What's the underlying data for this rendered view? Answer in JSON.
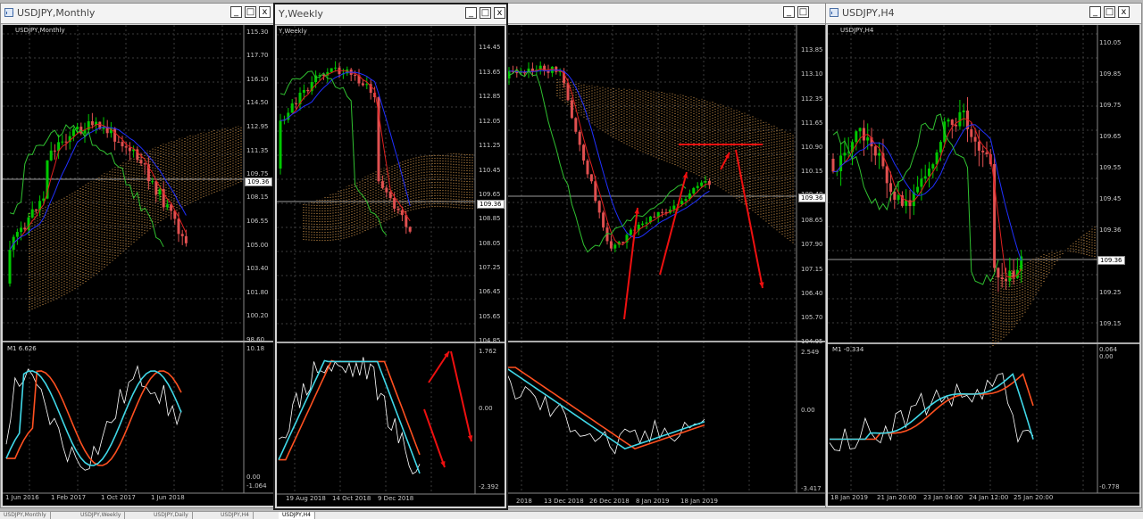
{
  "colors": {
    "bull": "#00c800",
    "bear": "#e05050",
    "tenkan": "#e02020",
    "kijun": "#2030ff",
    "chikou": "#30c030",
    "cloud": "#e0a050",
    "osc_fast": "#40d8e8",
    "osc_slow": "#ff5020",
    "osc_line": "#ffffff",
    "arrow": "#ee1010"
  },
  "windows": [
    {
      "title": "USDJPY,Monthly",
      "symbol_label": "USDJPY,Monthly",
      "indicator_label": "M1 6.626",
      "price_labels": [
        "115.30",
        "117.70",
        "116.10",
        "114.50",
        "112.95",
        "111.35",
        "109.75",
        "108.15",
        "106.55",
        "105.00",
        "103.40",
        "101.80",
        "100.20",
        "98.60"
      ],
      "current_price": "109.36",
      "osc_labels": [
        "10.18",
        "0.00",
        "-1.064"
      ],
      "time_labels": [
        "1 Jun 2016",
        "1 Feb 2017",
        "1 Oct 2017",
        "1 Jun 2018"
      ],
      "buttons": {
        "minimize": "_",
        "maximize": "□",
        "close": "x"
      }
    },
    {
      "title": "Y,Weekly",
      "symbol_label": "Y,Weekly",
      "price_labels": [
        "114.45",
        "113.65",
        "112.85",
        "112.05",
        "111.25",
        "110.45",
        "109.65",
        "108.85",
        "108.05",
        "107.25",
        "106.45",
        "105.65",
        "104.85"
      ],
      "current_price": "109.36",
      "osc_labels": [
        "1.762",
        "0.00",
        "-2.392"
      ],
      "time_labels": [
        "19 Aug 2018",
        "14 Oct 2018",
        "9 Dec 2018"
      ],
      "buttons": {
        "minimize": "_",
        "maximize": "□",
        "close": "x"
      }
    },
    {
      "title": "",
      "price_labels": [
        "113.85",
        "113.10",
        "112.35",
        "111.65",
        "110.90",
        "110.15",
        "109.40",
        "108.65",
        "107.90",
        "107.15",
        "106.40",
        "105.70",
        "104.95"
      ],
      "current_price": "109.36",
      "osc_labels": [
        "2.549",
        "0.00",
        "-3.417"
      ],
      "time_labels": [
        "2018",
        "13 Dec 2018",
        "26 Dec 2018",
        "8 Jan 2019",
        "18 Jan 2019"
      ],
      "buttons": {
        "minimize": "_",
        "maximize": "□"
      }
    },
    {
      "title": "USDJPY,H4",
      "symbol_label": "USDJPY,H4",
      "indicator_label": "M1 -0.334",
      "price_labels": [
        "110.05",
        "109.85",
        "109.75",
        "109.65",
        "109.55",
        "109.45",
        "109.36",
        "109.25",
        "109.15"
      ],
      "current_price": "109.36",
      "osc_labels": [
        "0.064",
        "0.00",
        "-0.778"
      ],
      "time_labels": [
        "18 Jan 2019",
        "21 Jan 20:00",
        "23 Jan 04:00",
        "24 Jan 12:00",
        "25 Jan 20:00"
      ],
      "buttons": {
        "minimize": "_",
        "maximize": "□",
        "close": "x"
      }
    }
  ],
  "tabs": [
    "USDJPY,Monthly",
    "USDJPY,Weekly",
    "USDJPY,Daily",
    "USDJPY,H4",
    "USDJPY,H4"
  ]
}
